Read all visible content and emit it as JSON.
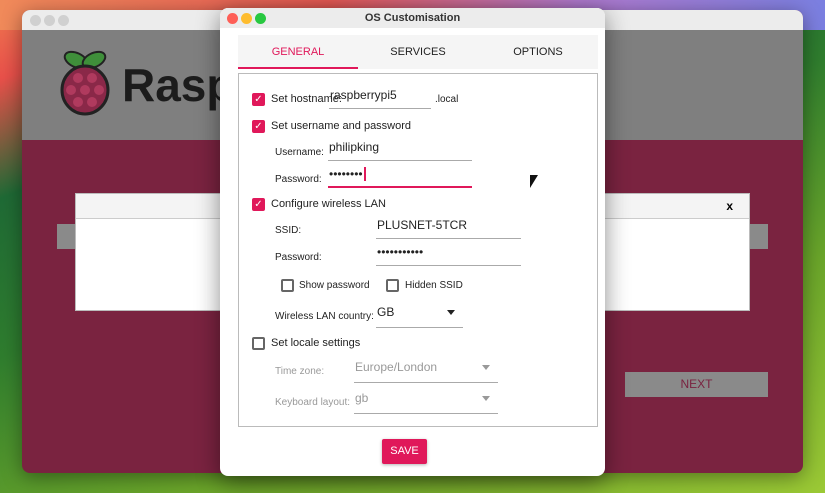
{
  "background_app": {
    "brand": "Rasp",
    "next_label": "NEXT",
    "close_label": "x"
  },
  "dialog": {
    "title": "OS Customisation",
    "tabs": [
      {
        "label": "GENERAL",
        "active": true
      },
      {
        "label": "SERVICES"
      },
      {
        "label": "OPTIONS"
      }
    ],
    "hostname": {
      "label": "Set hostname:",
      "checked": true,
      "value": "raspberrypi5",
      "suffix": ".local"
    },
    "user": {
      "label": "Set username and password",
      "checked": true,
      "username_label": "Username:",
      "username": "philipking",
      "password_label": "Password:",
      "password": "••••••••"
    },
    "wifi": {
      "label": "Configure wireless LAN",
      "checked": true,
      "ssid_label": "SSID:",
      "ssid": "PLUSNET-5TCR",
      "password_label": "Password:",
      "password": "•••••••••••",
      "show_password": "Show password",
      "show_password_checked": false,
      "hidden_ssid": "Hidden SSID",
      "hidden_ssid_checked": false,
      "country_label": "Wireless LAN country:",
      "country": "GB"
    },
    "locale": {
      "label": "Set locale settings",
      "checked": false,
      "timezone_label": "Time zone:",
      "timezone": "Europe/London",
      "keyboard_label": "Keyboard layout:",
      "keyboard": "gb"
    },
    "save_label": "SAVE"
  },
  "colors": {
    "accent": "#e0185a",
    "app_bg": "#7a2340"
  }
}
